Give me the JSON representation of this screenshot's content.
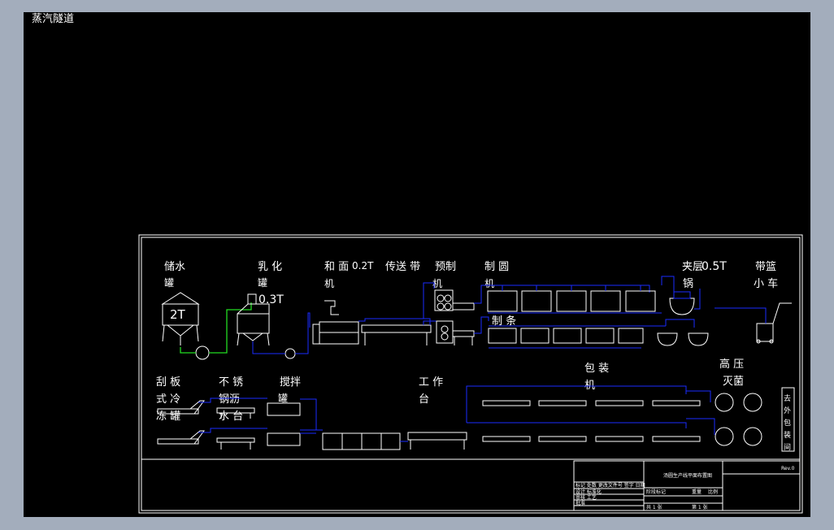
{
  "window": {
    "background": "#a3adbc",
    "canvas_color": "#000000",
    "line_color": "#ffffff",
    "pipe_color": "#1a2bff",
    "water_pipe_color": "#22dd22"
  },
  "header": {
    "title": "蒸汽隧道"
  },
  "labels": {
    "storage_tank": "储水",
    "storage_tank2": "罐",
    "tank_capacity": "2T",
    "emulsify": "乳 化",
    "emulsify2": "罐",
    "emulsify_cap": "0.3T",
    "mixer": "和 面",
    "mixer_cap": "0.2T",
    "mixer2": "机",
    "conveyor": "传送 带",
    "premake": "预制",
    "premake2": "机",
    "rounder": "制 圆",
    "rounder2": "机",
    "strip": "制 条",
    "jacket_pot": "夹层",
    "jacket_pot2": "锅",
    "jacket_cap": "0.5T",
    "basket_cart": "带篮",
    "basket_cart2": "小 车",
    "scraper": "刮 板",
    "scraper2": "式 冷",
    "scraper3": "冻 罐",
    "stainless": "不 锈",
    "stainless2": "钢沥",
    "stainless3": "水 台",
    "stirring": "搅拌",
    "stirring2": "罐",
    "workbench": "工 作",
    "workbench2": "台",
    "packaging": "包 装",
    "packaging2": "机",
    "sterilize": "高 压",
    "sterilize2": "灭菌",
    "outer_pack": [
      "去",
      "外",
      "包",
      "装",
      "间"
    ]
  },
  "title_block": {
    "drawing_title": "汤圆生产线平面布置图",
    "rev": "Rev.0",
    "row1": "标记 处数 更改文件号 签字 日期",
    "row2": "设计 标准化",
    "row3": "审核 工艺",
    "row4": "批准",
    "stage": "阶段标记",
    "weight": "重量",
    "scale": "比例",
    "sheet": "共 1 张",
    "sheet2": "第 1 张"
  }
}
